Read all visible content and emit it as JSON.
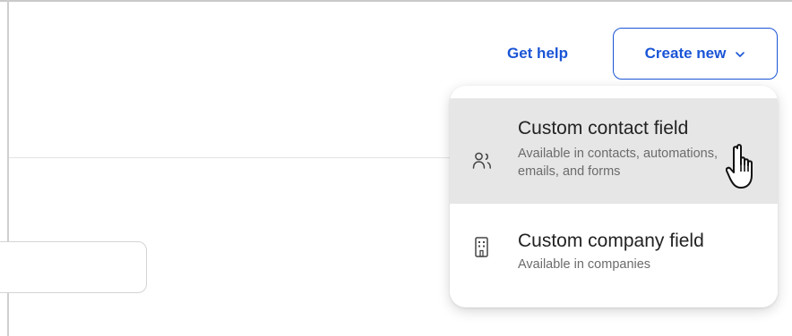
{
  "header": {
    "get_help_label": "Get help",
    "create_new_label": "Create new"
  },
  "menu": {
    "items": [
      {
        "title": "Custom contact field",
        "description": "Available in contacts, automations, emails, and forms",
        "icon": "contacts-icon"
      },
      {
        "title": "Custom company field",
        "description": "Available in companies",
        "icon": "building-icon"
      }
    ]
  },
  "colors": {
    "accent": "#1a55d6",
    "hover_background": "#e6e6e6"
  }
}
